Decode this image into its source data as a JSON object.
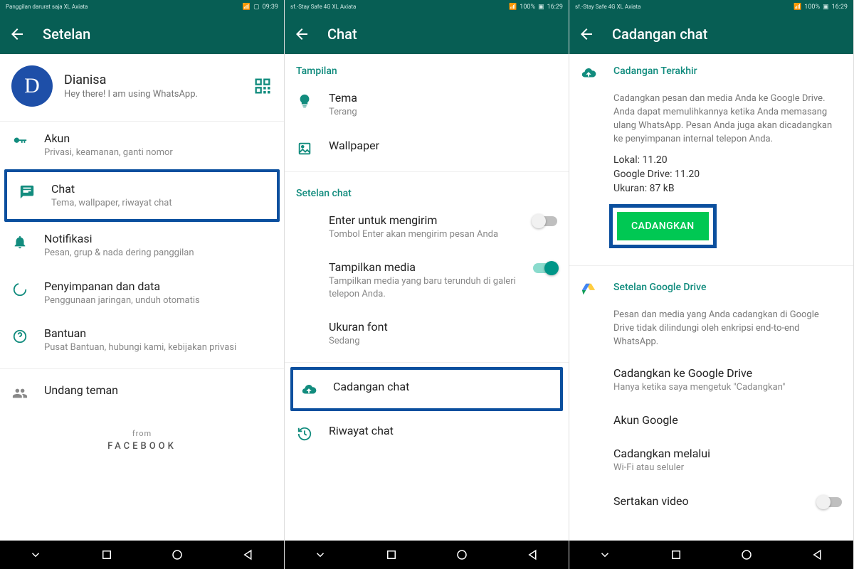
{
  "screen1": {
    "statusbar": {
      "left": "Panggilan darurat saja\nXL Axiata",
      "time": "09:39"
    },
    "appbar": {
      "title": "Setelan"
    },
    "profile": {
      "initial": "D",
      "name": "Dianisa",
      "status": "Hey there! I am using WhatsApp."
    },
    "items": [
      {
        "label": "Akun",
        "sub": "Privasi, keamanan, ganti nomor"
      },
      {
        "label": "Chat",
        "sub": "Tema, wallpaper, riwayat chat"
      },
      {
        "label": "Notifikasi",
        "sub": "Pesan, grup & nada dering panggilan"
      },
      {
        "label": "Penyimpanan dan data",
        "sub": "Penggunaan jaringan, unduh otomatis"
      },
      {
        "label": "Bantuan",
        "sub": "Pusat Bantuan, hubungi kami, kebijakan privasi"
      },
      {
        "label": "Undang teman",
        "sub": ""
      }
    ],
    "footer": {
      "from": "from",
      "brand": "FACEBOOK"
    }
  },
  "screen2": {
    "statusbar": {
      "left": "sf.-Stay Safe 4G\nXL Axiata",
      "right": "100%",
      "time": "16:29"
    },
    "appbar": {
      "title": "Chat"
    },
    "section1": "Tampilan",
    "tema": {
      "label": "Tema",
      "sub": "Terang"
    },
    "wallpaper": {
      "label": "Wallpaper"
    },
    "section2": "Setelan chat",
    "enter": {
      "label": "Enter untuk mengirim",
      "sub": "Tombol Enter akan mengirim pesan Anda"
    },
    "media": {
      "label": "Tampilkan media",
      "sub": "Tampilkan media yang baru terunduh di galeri telepon Anda."
    },
    "font": {
      "label": "Ukuran font",
      "sub": "Sedang"
    },
    "backup": {
      "label": "Cadangan chat"
    },
    "history": {
      "label": "Riwayat chat"
    }
  },
  "screen3": {
    "statusbar": {
      "left": "sf.-Stay Safe 4G\nXL Axiata",
      "right": "100%",
      "time": "16:29"
    },
    "appbar": {
      "title": "Cadangan chat"
    },
    "sectionA": "Cadangan Terakhir",
    "desc": "Cadangkan pesan dan media Anda ke Google Drive. Anda dapat memulihkannya ketika Anda memasang ulang WhatsApp. Pesan Anda juga akan dicadangkan ke penyimpanan internal telepon Anda.",
    "kv": {
      "lokal": "Lokal: 11.20",
      "gdrive": "Google Drive: 11.20",
      "ukuran": "Ukuran: 87 kB"
    },
    "button": "CADANGKAN",
    "sectionB": "Setelan Google Drive",
    "descB": "Pesan dan media yang Anda cadangkan di Google Drive tidak dilindungi oleh enkripsi end-to-end WhatsApp.",
    "gd1": {
      "label": "Cadangkan ke Google Drive",
      "sub": "Hanya ketika saya mengetuk \"Cadangkan\""
    },
    "gd2": {
      "label": "Akun Google"
    },
    "gd3": {
      "label": "Cadangkan melalui",
      "sub": "Wi-Fi atau seluler"
    },
    "gd4": {
      "label": "Sertakan video"
    }
  }
}
